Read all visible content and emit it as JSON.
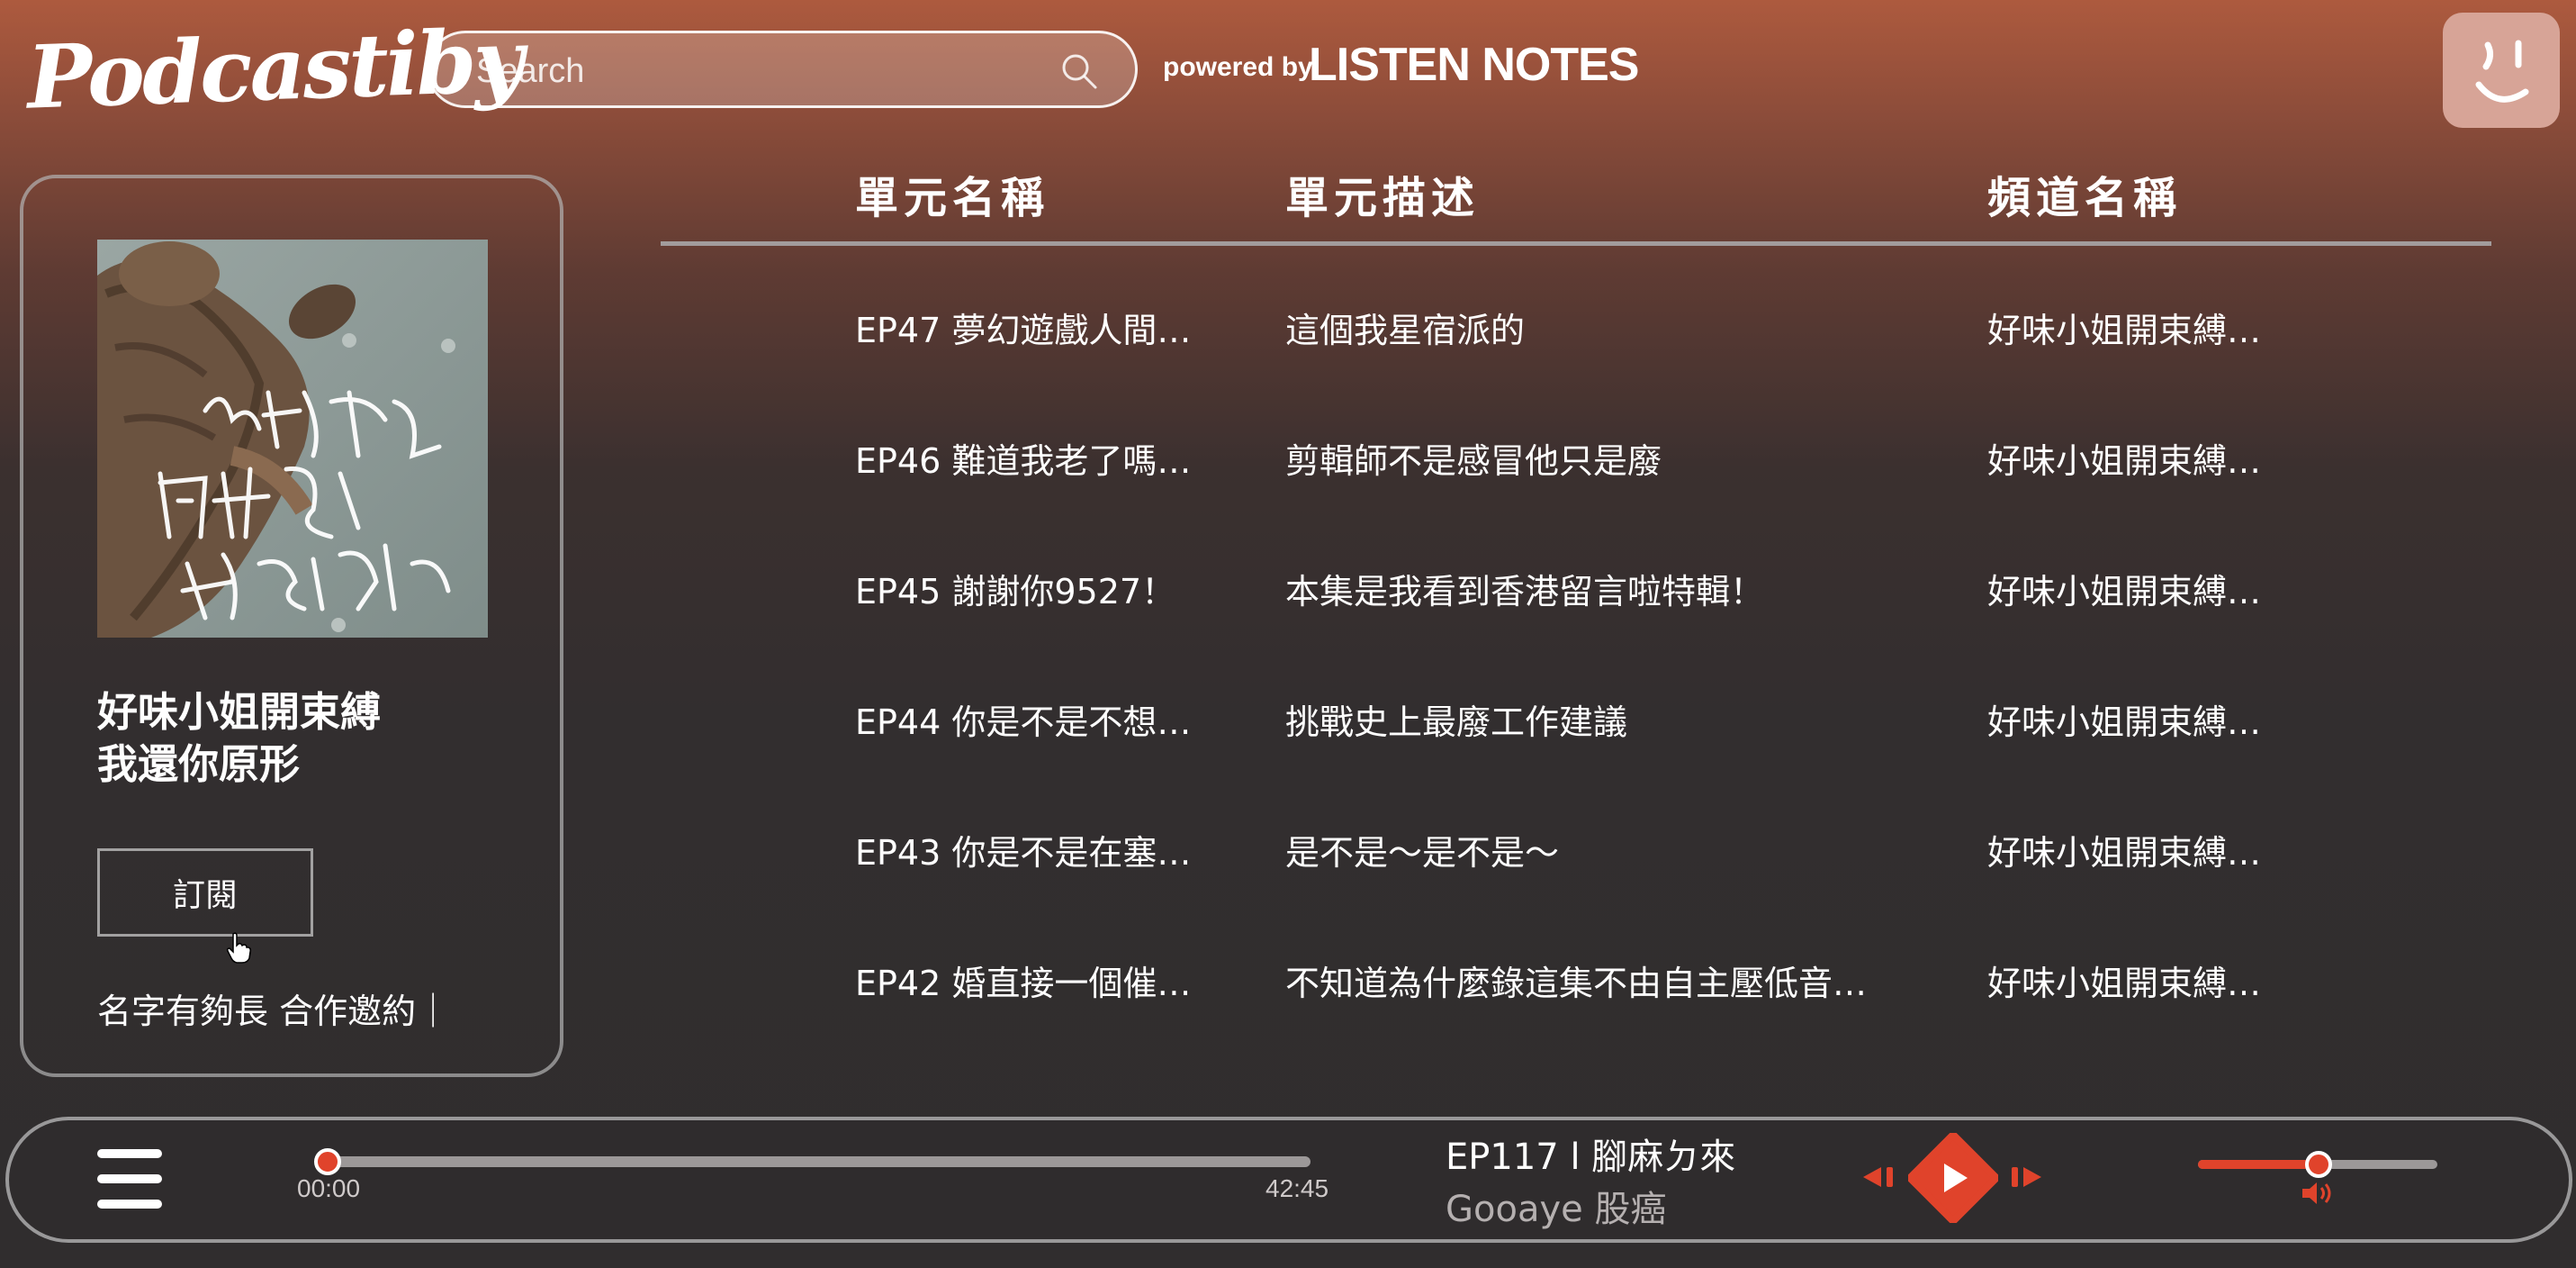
{
  "header": {
    "logo": "Podcastiby",
    "search_placeholder": "Search",
    "powered_by": "powered by",
    "brand": "LISTEN NOTES"
  },
  "sidebar": {
    "show_title_line1": "好味小姐開束縛",
    "show_title_line2": "我還你原形",
    "subscribe_label": "訂閱",
    "description": "名字有夠長 合作邀約｜"
  },
  "table": {
    "headers": [
      "單元名稱",
      "單元描述",
      "頻道名稱"
    ],
    "rows": [
      {
        "title": "EP47 夢幻遊戲人間…",
        "desc": "這個我星宿派的",
        "channel": "好味小姐開束縛…"
      },
      {
        "title": "EP46 難道我老了嗎…",
        "desc": "剪輯師不是感冒他只是廢",
        "channel": "好味小姐開束縛…"
      },
      {
        "title": "EP45 謝謝你9527！",
        "desc": "本集是我看到香港留言啦特輯！",
        "channel": "好味小姐開束縛…"
      },
      {
        "title": "EP44 你是不是不想…",
        "desc": "挑戰史上最廢工作建議",
        "channel": "好味小姐開束縛…"
      },
      {
        "title": "EP43 你是不是在塞…",
        "desc": "是不是～是不是～",
        "channel": "好味小姐開束縛…"
      },
      {
        "title": "EP42 婚直接一個催…",
        "desc": "不知道為什麼錄這集不由自主壓低音…",
        "channel": "好味小姐開束縛…"
      }
    ]
  },
  "player": {
    "current_time": "00:00",
    "duration": "42:45",
    "progress": 0.0,
    "episode_title": "EP117 l 腳麻ㄉ來",
    "artist": "Gooaye 股癌",
    "volume": 0.5,
    "accent_color": "#e0432b"
  }
}
